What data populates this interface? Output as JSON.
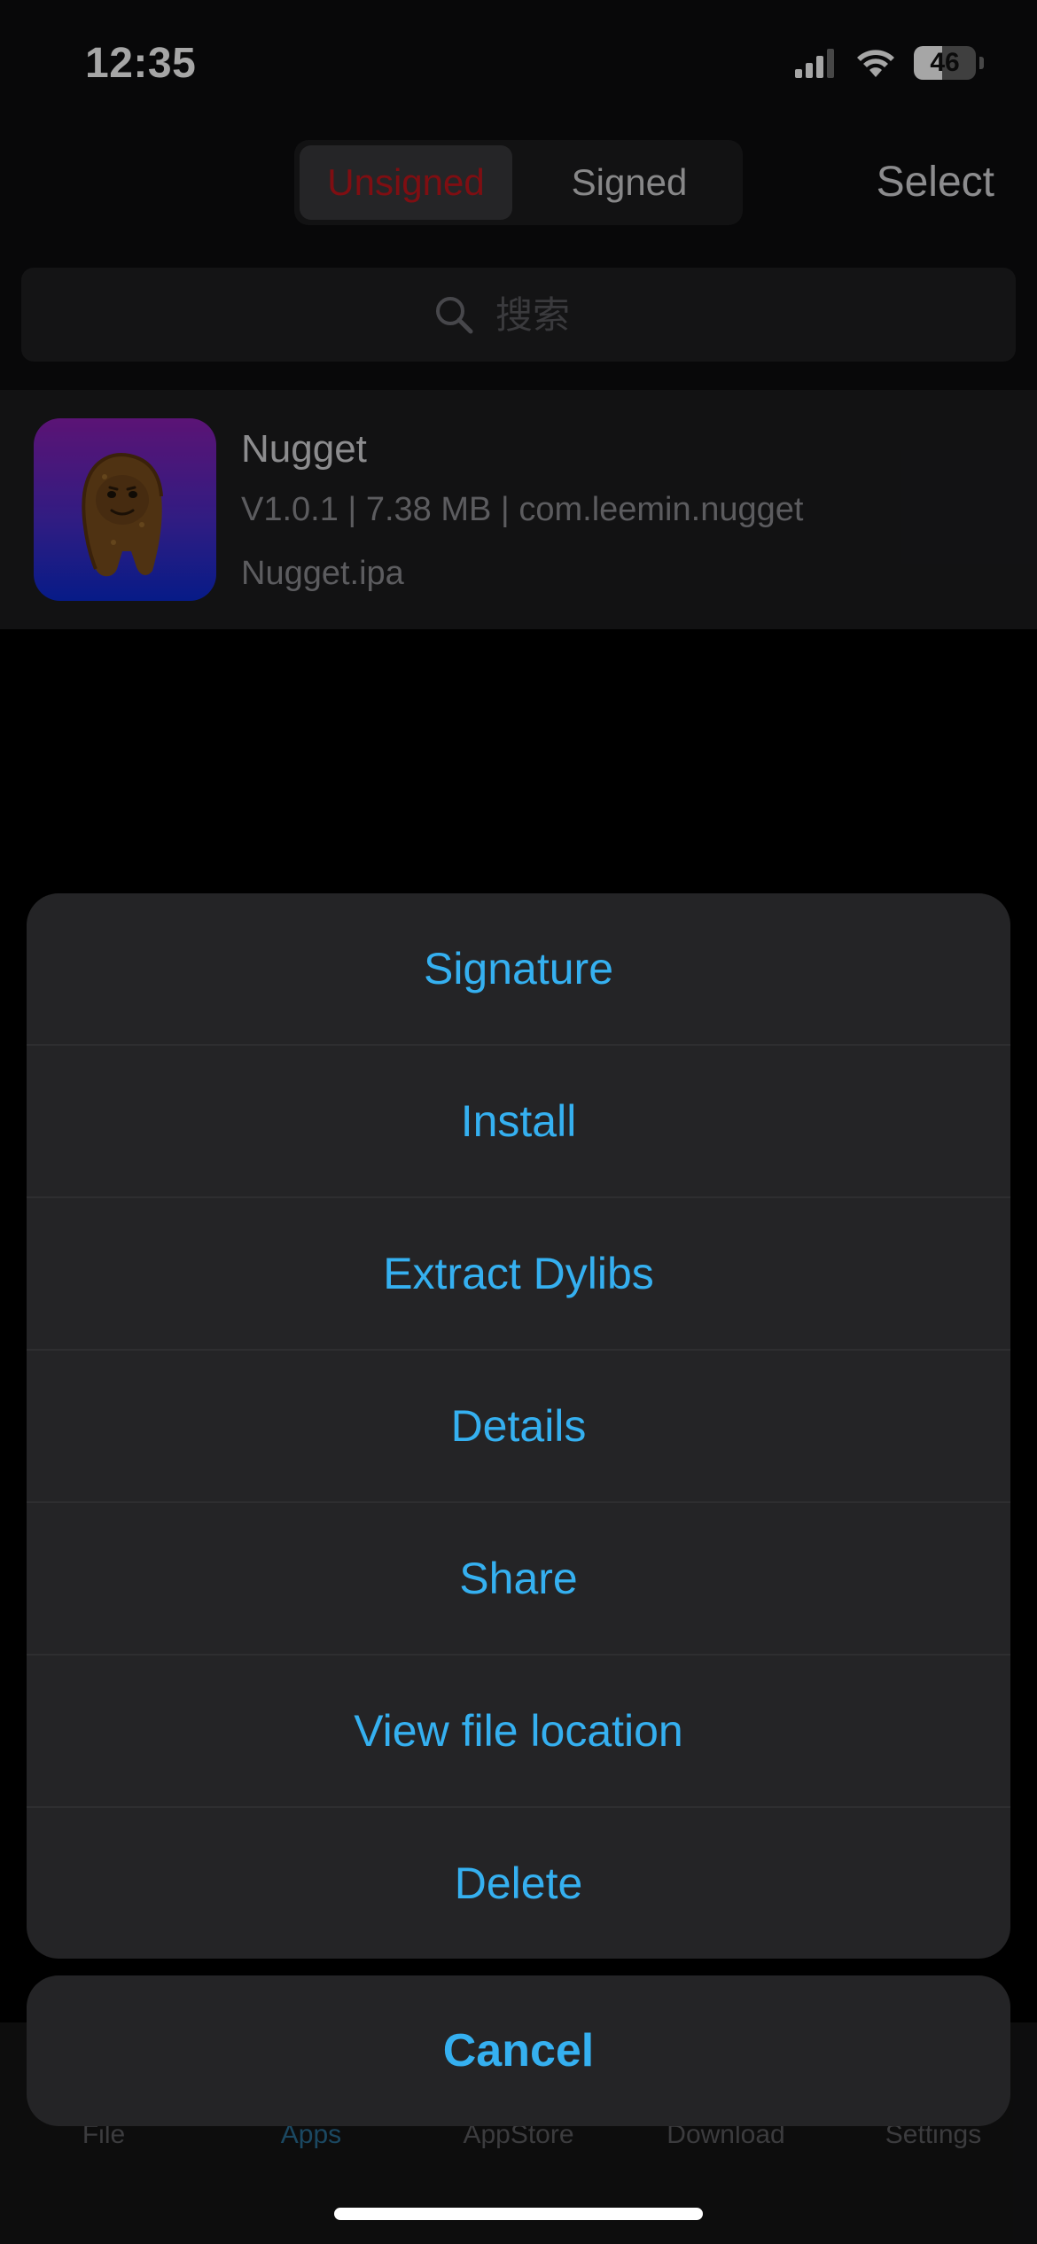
{
  "status_bar": {
    "time": "12:35",
    "battery_level": "46",
    "battery_fraction": 0.46
  },
  "header": {
    "segments": [
      {
        "label": "Unsigned",
        "selected": true
      },
      {
        "label": "Signed",
        "selected": false
      }
    ],
    "select_label": "Select"
  },
  "search": {
    "placeholder": "搜索"
  },
  "apps": [
    {
      "name": "Nugget",
      "meta": "V1.0.1 | 7.38 MB | com.leemin.nugget",
      "file": "Nugget.ipa"
    }
  ],
  "action_sheet": {
    "items": [
      "Signature",
      "Install",
      "Extract Dylibs",
      "Details",
      "Share",
      "View file location",
      "Delete"
    ],
    "cancel_label": "Cancel"
  },
  "tab_bar": {
    "items": [
      "File",
      "Apps",
      "AppStore",
      "Download",
      "Settings"
    ],
    "active": "Apps"
  },
  "colors": {
    "accent": "#35b0f0",
    "selected_segment_text": "#c4161c",
    "background": "#000000",
    "sheet": "#242426"
  }
}
